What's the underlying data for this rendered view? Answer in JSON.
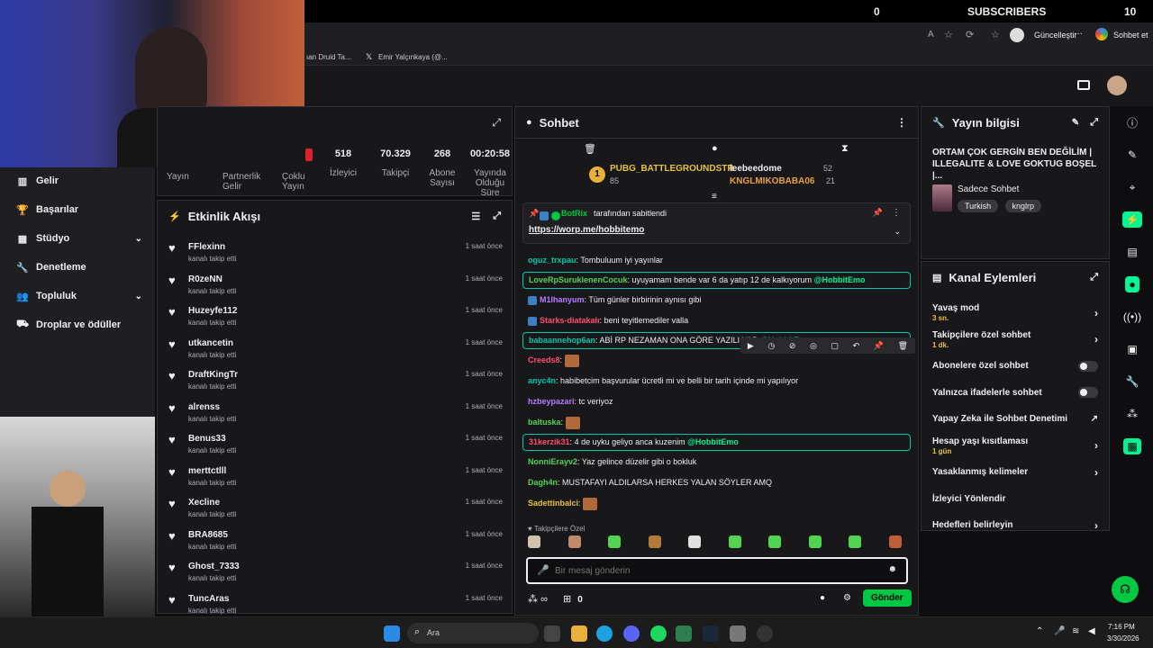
{
  "topbar": {
    "count": "0",
    "subscribers_label": "SUBSCRIBERS",
    "sub_count": "10"
  },
  "browser": {
    "update_label": "Güncelleştir",
    "chat_label": "Sohbet et",
    "dots": "···"
  },
  "bookmarks": [
    "ıan Druid Ta...",
    "Emir Yalçınkaya (@..."
  ],
  "leftnav": [
    {
      "label": "Gelir",
      "chevron": false
    },
    {
      "label": "Başarılar",
      "chevron": false
    },
    {
      "label": "Stüdyo",
      "chevron": true
    },
    {
      "label": "Denetleme",
      "chevron": false
    },
    {
      "label": "Topluluk",
      "chevron": true
    },
    {
      "label": "Droplar ve ödüller",
      "chevron": false
    }
  ],
  "stats": {
    "values": [
      "518",
      "70.329",
      "268",
      "00:20:58"
    ],
    "labels": [
      "İzleyici",
      "Takipçi",
      "Abone Sayısı",
      "Yayında Olduğu Süre"
    ],
    "left_labels": [
      "Yayın",
      "Partnerlik Gelir",
      "Çoklu Yayın"
    ]
  },
  "activity": {
    "title": "Etkinlik Akışı",
    "items": [
      {
        "name": "FFlexinn",
        "sub": "kanalı takip etti",
        "time": "1 saat önce"
      },
      {
        "name": "R0zeNN",
        "sub": "kanalı takip etti",
        "time": "1 saat önce"
      },
      {
        "name": "Huzeyfe112",
        "sub": "kanalı takip etti",
        "time": "1 saat önce"
      },
      {
        "name": "utkancetin",
        "sub": "kanalı takip etti",
        "time": "1 saat önce"
      },
      {
        "name": "DraftKingTr",
        "sub": "kanalı takip etti",
        "time": "1 saat önce"
      },
      {
        "name": "alrenss",
        "sub": "kanalı takip etti",
        "time": "1 saat önce"
      },
      {
        "name": "Benus33",
        "sub": "kanalı takip etti",
        "time": "1 saat önce"
      },
      {
        "name": "merttctlll",
        "sub": "kanalı takip etti",
        "time": "1 saat önce"
      },
      {
        "name": "Xecline",
        "sub": "kanalı takip etti",
        "time": "1 saat önce"
      },
      {
        "name": "BRA8685",
        "sub": "kanalı takip etti",
        "time": "1 saat önce"
      },
      {
        "name": "Ghost_7333",
        "sub": "kanalı takip etti",
        "time": "1 saat önce"
      },
      {
        "name": "TuncAras",
        "sub": "kanalı takip etti",
        "time": "1 saat önce"
      }
    ]
  },
  "chat": {
    "title": "Sohbet",
    "leaderboard": {
      "rank": "1",
      "first_name": "PUBG_BATTLEGROUNDSTR",
      "first_value": "85",
      "second_name": "leebeedome",
      "second_value": "52",
      "third_name": "KNGLMIKOBABA06",
      "third_value": "21"
    },
    "pinned": {
      "by_name": "BotRix",
      "by_text": "tarafından sabitlendi",
      "link": "https://worp.me/hobbitemo"
    },
    "messages": [
      {
        "user": "oguz_trxpau",
        "color": "#00c8af",
        "text": "Tombuluum iyi yayınlar",
        "boxed": false,
        "mention": ""
      },
      {
        "user": "LoveRpSuruklenenCocuk",
        "color": "#52d452",
        "text": "uyuyamam bende var 6 da yatıp 12 de kalkıyorum",
        "boxed": true,
        "mention": "@HobbitEmo"
      },
      {
        "user": "M1lhanyum",
        "color": "#b57bff",
        "text": "Tüm günler birbirinin aynısı gibi",
        "boxed": false,
        "mention": ""
      },
      {
        "user": "Starks-diatakalı",
        "color": "#ff4d6d",
        "text": "beni teyitlemediler valla",
        "boxed": false,
        "mention": ""
      },
      {
        "user": "babaannehop6an",
        "color": "#00c8af",
        "text": "ABİ RP NEZAMAN ONA GÖRE YAZILI VAR",
        "boxed": true,
        "mention": "@HobbitEmo"
      },
      {
        "user": "Creeds8",
        "color": "#ff4d6d",
        "text": "",
        "boxed": false,
        "mention": ""
      },
      {
        "user": "anyc4n",
        "color": "#00c8af",
        "text": "habibetcim başvurular ücretli mi ve belli bir tarih içinde mi yapılıyor",
        "boxed": false,
        "mention": ""
      },
      {
        "user": "hzbeypazari",
        "color": "#b57bff",
        "text": "tc veriyoz",
        "boxed": false,
        "mention": ""
      },
      {
        "user": "baltuska",
        "color": "#52d452",
        "text": "",
        "boxed": false,
        "mention": ""
      },
      {
        "user": "31kerzik31",
        "color": "#ff4d6d",
        "text": "4 de uyku geliyo anca kuzenim",
        "boxed": true,
        "mention": "@HobbitEmo"
      },
      {
        "user": "NonniErayv2",
        "color": "#52d452",
        "text": "Yaz gelince düzelir gibi o bokluk",
        "boxed": false,
        "mention": ""
      },
      {
        "user": "Dagh4n",
        "color": "#52d452",
        "text": "MUSTAFAYI ALDILARSA HERKES YALAN SÖYLER AMQ",
        "boxed": false,
        "mention": ""
      },
      {
        "user": "Sadettinbalci",
        "color": "#e8c23a",
        "text": "",
        "boxed": false,
        "mention": ""
      }
    ],
    "followers_only": "Takipçilere Özel",
    "input_placeholder": "Bir mesaj gönderin",
    "bottom_count": "0",
    "send_label": "Gönder"
  },
  "info": {
    "title": "Yayın bilgisi",
    "stream_title": "ORTAM ÇOK GERGİN BEN DEĞİLİM | ILLEGALITE & LOVE GOKTUG BOŞEL |...",
    "category": "Sadece Sohbet",
    "tags": [
      "Turkish",
      "knglrp"
    ]
  },
  "actions": {
    "title": "Kanal Eylemleri",
    "rows": [
      {
        "label": "Yavaş mod",
        "sub": "3 sn.",
        "kind": "chevron"
      },
      {
        "label": "Takipçilere özel sohbet",
        "sub": "1 dk.",
        "kind": "chevron"
      },
      {
        "label": "Abonelere özel sohbet",
        "sub": "",
        "kind": "toggle"
      },
      {
        "label": "Yalnızca ifadelerle sohbet",
        "sub": "",
        "kind": "toggle"
      },
      {
        "label": "Yapay Zeka ile Sohbet Denetimi",
        "sub": "",
        "kind": "external"
      },
      {
        "label": "Hesap yaşı kısıtlaması",
        "sub": "1 gün",
        "kind": "chevron"
      },
      {
        "label": "Yasaklanmış kelimeler",
        "sub": "",
        "kind": "chevron"
      },
      {
        "label": "İzleyici Yönlendir",
        "sub": "",
        "kind": "none"
      },
      {
        "label": "Hedefleri belirleyin",
        "sub": "",
        "kind": "chevron"
      }
    ]
  },
  "taskbar": {
    "search_placeholder": "Ara",
    "time": "7:16 PM",
    "date": "3/30/2026"
  },
  "colors": {
    "accent": "#00f593",
    "teal": "#00c8af",
    "send": "#00c843"
  }
}
